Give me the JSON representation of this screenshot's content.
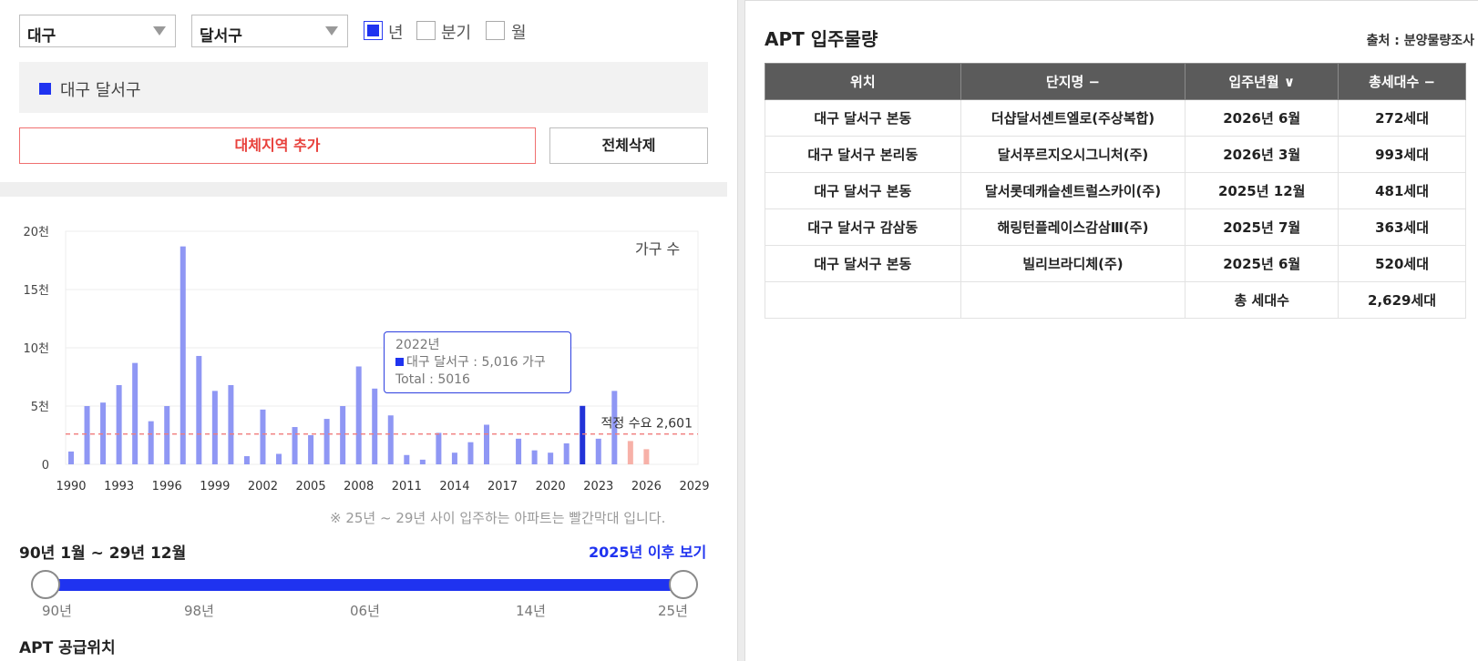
{
  "filters": {
    "region": "대구",
    "district": "달서구",
    "period_options": [
      {
        "label": "년",
        "checked": true
      },
      {
        "label": "분기",
        "checked": false
      },
      {
        "label": "월",
        "checked": false
      }
    ]
  },
  "legend_item": "대구 달서구",
  "buttons": {
    "add_region": "대체지역 추가",
    "delete_all": "전체삭제"
  },
  "chart_data": {
    "type": "bar",
    "ylabel_text": "가구 수",
    "yticks": [
      "0",
      "5천",
      "10천",
      "15천",
      "20천"
    ],
    "ylim": [
      0,
      20000
    ],
    "xlim": [
      1990,
      2029
    ],
    "xtick_labels": [
      "1990",
      "1993",
      "1996",
      "1999",
      "2002",
      "2005",
      "2008",
      "2011",
      "2014",
      "2017",
      "2020",
      "2023",
      "2026",
      "2029"
    ],
    "series": [
      {
        "name": "대구 달서구",
        "x": [
          1990,
          1991,
          1992,
          1993,
          1994,
          1995,
          1996,
          1997,
          1998,
          1999,
          2000,
          2001,
          2002,
          2003,
          2004,
          2005,
          2006,
          2007,
          2008,
          2009,
          2010,
          2011,
          2012,
          2013,
          2014,
          2015,
          2016,
          2018,
          2019,
          2020,
          2021,
          2022,
          2023,
          2024,
          2025,
          2026
        ],
        "values": [
          1100,
          5000,
          5300,
          6800,
          8700,
          3700,
          5000,
          18700,
          9300,
          6300,
          6800,
          700,
          4700,
          900,
          3200,
          2500,
          3900,
          5000,
          8400,
          6500,
          4200,
          800,
          400,
          2700,
          1000,
          1900,
          3400,
          2200,
          1200,
          1000,
          1800,
          5016,
          2200,
          6300,
          2000,
          1300
        ]
      }
    ],
    "colors": {
      "normal": "#8f97f4",
      "highlight": "#2233d8",
      "future": "#f7b1a8",
      "demand_line": "#f07b7b"
    },
    "highlight_x": 2022,
    "future_from": 2025,
    "demand": {
      "label": "적정 수요 2,601",
      "value": 2601
    },
    "tooltip": {
      "year": "2022년",
      "line": "대구 달서구 : 5,016 가구",
      "total": "Total : 5016"
    }
  },
  "note": "※ 25년 ~ 29년 사이 입주하는 아파트는 빨간막대 입니다.",
  "range_label": "90년 1월 ~ 29년 12월",
  "after_link": "2025년 이후 보기",
  "slider_ticks": [
    "90년",
    "98년",
    "06년",
    "14년",
    "25년"
  ],
  "section_title": "APT 공급위치",
  "right": {
    "title": "APT 입주물량",
    "source": "출처 : 분양물량조사",
    "headers": [
      "위치",
      "단지명 −",
      "입주년월 ∨",
      "총세대수 −"
    ],
    "rows": [
      [
        "대구 달서구 본동",
        "더샵달서센트엘로(주상복합)",
        "2026년 6월",
        "272세대"
      ],
      [
        "대구 달서구 본리동",
        "달서푸르지오시그니처(주)",
        "2026년 3월",
        "993세대"
      ],
      [
        "대구 달서구 본동",
        "달서롯데캐슬센트럴스카이(주)",
        "2025년 12월",
        "481세대"
      ],
      [
        "대구 달서구 감삼동",
        "해링턴플레이스감삼Ⅲ(주)",
        "2025년 7월",
        "363세대"
      ],
      [
        "대구 달서구 본동",
        "빌리브라디체(주)",
        "2025년 6월",
        "520세대"
      ]
    ],
    "total_label": "총 세대수",
    "total_value": "2,629세대"
  }
}
